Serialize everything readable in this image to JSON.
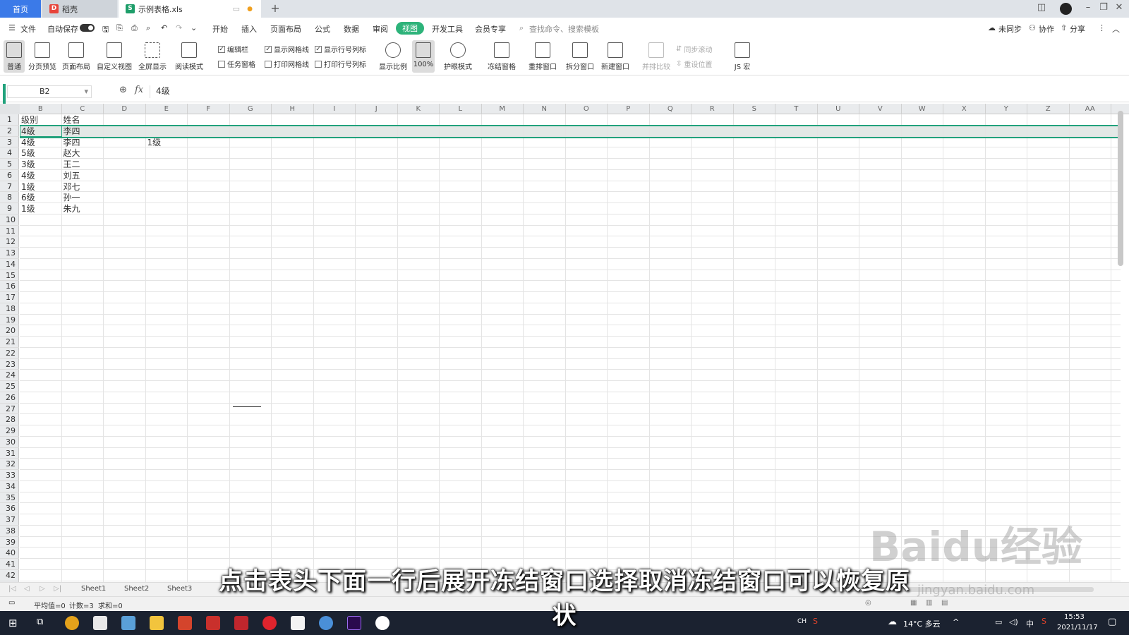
{
  "tabs": {
    "home": "首页",
    "daoke": "稻壳",
    "file": "示例表格.xls"
  },
  "menu": {
    "file": "文件",
    "autosave": "自动保存",
    "items": [
      "开始",
      "插入",
      "页面布局",
      "公式",
      "数据",
      "审阅",
      "视图",
      "开发工具",
      "会员专享"
    ],
    "search": "查找命令、搜索模板",
    "sync": "未同步",
    "collab": "协作",
    "share": "分享"
  },
  "ribbon": {
    "normal": "普通",
    "page_break": "分页预览",
    "page_layout": "页面布局",
    "custom_view": "自定义视图",
    "fullscreen": "全屏显示",
    "reading": "阅读模式",
    "chk_editbar": "编辑栏",
    "chk_taskpane": "任务窗格",
    "chk_gridlines": "显示网格线",
    "chk_printgrid": "打印网格线",
    "chk_headers": "显示行号列标",
    "chk_printheaders": "打印行号列标",
    "zoom": "显示比例",
    "zoom100": "100%",
    "eyecare": "护眼模式",
    "freeze": "冻结窗格",
    "arrange": "重排窗口",
    "split": "拆分窗口",
    "new_window": "新建窗口",
    "side_by_side": "并排比较",
    "sync_scroll": "同步滚动",
    "reset_pos": "重设位置",
    "macro": "JS 宏"
  },
  "formula": {
    "namebox": "B2",
    "fx": "fx",
    "value": "4级"
  },
  "columns": [
    "B",
    "C",
    "D",
    "E",
    "F",
    "G",
    "H",
    "I",
    "J",
    "K",
    "L",
    "M",
    "N",
    "O",
    "P",
    "Q",
    "R",
    "S",
    "T",
    "U",
    "V",
    "W",
    "X",
    "Y",
    "Z",
    "AA"
  ],
  "rows": [
    "1",
    "2",
    "3",
    "4",
    "5",
    "6",
    "7",
    "8",
    "9",
    "10",
    "11",
    "12",
    "13",
    "14",
    "15",
    "16",
    "17",
    "18",
    "19",
    "20",
    "21",
    "22",
    "23",
    "24",
    "25",
    "26",
    "27",
    "28",
    "29",
    "30",
    "31",
    "32",
    "33",
    "34",
    "35",
    "36",
    "37",
    "38",
    "39",
    "40",
    "41",
    "42"
  ],
  "data": [
    [
      "级别",
      "姓名"
    ],
    [
      "4级",
      "李四"
    ],
    [
      "4级",
      "李四"
    ],
    [
      "5级",
      "赵大"
    ],
    [
      "3级",
      "王二"
    ],
    [
      "4级",
      "刘五"
    ],
    [
      "1级",
      "邓七"
    ],
    [
      "6级",
      "孙一"
    ],
    [
      "1级",
      "朱九"
    ]
  ],
  "extra_cell": "1级",
  "sheets": [
    "Sheet1",
    "Sheet2",
    "Sheet3"
  ],
  "status": {
    "avg": "平均值=0",
    "count": "计数=3",
    "sum": "求和=0"
  },
  "taskbar": {
    "weather": "14°C 多云",
    "ime": "中",
    "time": "15:53",
    "date": "2021/11/17",
    "lang": "CH"
  },
  "subtitle": "点击表头下面一行后展开冻结窗口选择取消冻结窗口可以恢复原状",
  "watermark": "Baidu经验",
  "watermark_url": "jingyan.baidu.com",
  "colors": {
    "accent": "#2db37a",
    "tab_blue": "#3b7ae8",
    "freeze_line": "#21a27c"
  }
}
